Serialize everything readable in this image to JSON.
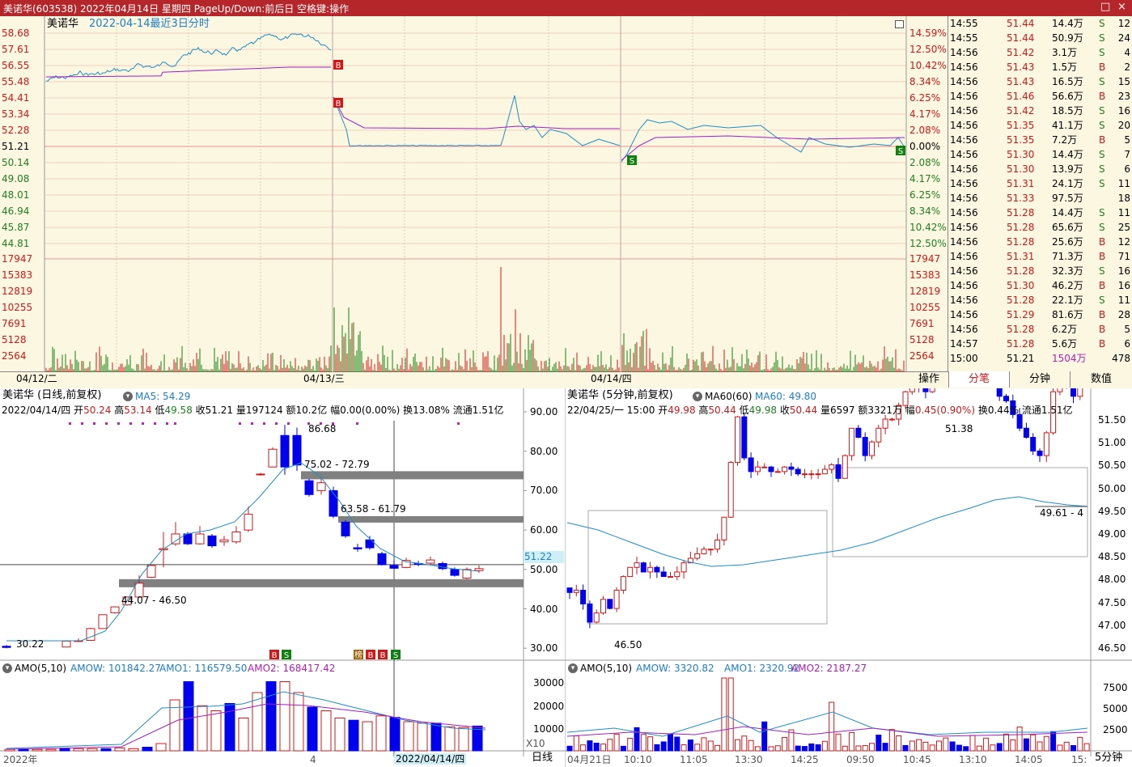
{
  "window": {
    "title": "美诺华(603538) 2022年04月14日 星期四 PageUp/Down:前后日 空格键:操作",
    "btn_restore": "□",
    "btn_close": "×"
  },
  "intraday": {
    "name": "美诺华",
    "period": "2022-04-14最近3日分时",
    "price_labels": [
      "58.68",
      "57.61",
      "56.55",
      "55.48",
      "54.41",
      "53.34",
      "52.28",
      "51.21",
      "50.14",
      "49.08",
      "48.01",
      "46.94",
      "45.87",
      "44.81"
    ],
    "pct_labels": [
      "14.59%",
      "12.50%",
      "10.42%",
      "8.34%",
      "6.25%",
      "4.17%",
      "2.08%",
      "0.00%",
      "2.08%",
      "4.17%",
      "6.25%",
      "8.34%",
      "10.42%",
      "12.50%"
    ],
    "vol_labels": [
      "17947",
      "15383",
      "12819",
      "10255",
      "7691",
      "5128",
      "2564"
    ],
    "dates": [
      "04/12/二",
      "04/13/三",
      "04/14/四"
    ],
    "markers": [
      "B",
      "B",
      "S",
      "S"
    ]
  },
  "ticks": [
    {
      "time": "14:55",
      "price": "51.44",
      "vol": "14.4万",
      "bs": "S",
      "n": "12"
    },
    {
      "time": "14:55",
      "price": "51.44",
      "vol": "50.9万",
      "bs": "S",
      "n": "24"
    },
    {
      "time": "14:56",
      "price": "51.42",
      "vol": "3.1万",
      "bs": "S",
      "n": "4"
    },
    {
      "time": "14:56",
      "price": "51.43",
      "vol": "1.5万",
      "bs": "B",
      "n": "2"
    },
    {
      "time": "14:56",
      "price": "51.43",
      "vol": "16.5万",
      "bs": "S",
      "n": "15"
    },
    {
      "time": "14:56",
      "price": "51.46",
      "vol": "56.6万",
      "bs": "B",
      "n": "23"
    },
    {
      "time": "14:56",
      "price": "51.42",
      "vol": "18.5万",
      "bs": "S",
      "n": "16"
    },
    {
      "time": "14:56",
      "price": "51.35",
      "vol": "41.1万",
      "bs": "S",
      "n": "20"
    },
    {
      "time": "14:56",
      "price": "51.35",
      "vol": "7.2万",
      "bs": "B",
      "n": "5"
    },
    {
      "time": "14:56",
      "price": "51.30",
      "vol": "14.4万",
      "bs": "S",
      "n": "7"
    },
    {
      "time": "14:56",
      "price": "51.30",
      "vol": "13.9万",
      "bs": "S",
      "n": "6"
    },
    {
      "time": "14:56",
      "price": "51.31",
      "vol": "24.1万",
      "bs": "S",
      "n": "11"
    },
    {
      "time": "14:56",
      "price": "51.33",
      "vol": "97.5万",
      "bs": "",
      "n": "18"
    },
    {
      "time": "14:56",
      "price": "51.28",
      "vol": "14.4万",
      "bs": "S",
      "n": "11"
    },
    {
      "time": "14:56",
      "price": "51.28",
      "vol": "65.6万",
      "bs": "S",
      "n": "25"
    },
    {
      "time": "14:56",
      "price": "51.28",
      "vol": "25.6万",
      "bs": "B",
      "n": "12"
    },
    {
      "time": "14:56",
      "price": "51.31",
      "vol": "71.3万",
      "bs": "B",
      "n": "71"
    },
    {
      "time": "14:56",
      "price": "51.28",
      "vol": "32.3万",
      "bs": "S",
      "n": "16"
    },
    {
      "time": "14:56",
      "price": "51.30",
      "vol": "46.2万",
      "bs": "B",
      "n": "16"
    },
    {
      "time": "14:56",
      "price": "51.28",
      "vol": "22.1万",
      "bs": "S",
      "n": "11"
    },
    {
      "time": "14:56",
      "price": "51.29",
      "vol": "81.6万",
      "bs": "B",
      "n": "28"
    },
    {
      "time": "14:56",
      "price": "51.28",
      "vol": "6.2万",
      "bs": "B",
      "n": "5"
    },
    {
      "time": "14:57",
      "price": "51.28",
      "vol": "5.6万",
      "bs": "B",
      "n": "6"
    },
    {
      "time": "15:00",
      "price": "51.21",
      "vol": "1504万",
      "bs": "",
      "n": "478"
    }
  ],
  "tabs": [
    "操作",
    "分笔",
    "分钟",
    "数值"
  ],
  "daily": {
    "title": "美诺华 (日线,前复权)",
    "ma_label": "MA5: 54.29",
    "info_date": "2022/04/14/四",
    "open_l": "开",
    "open": "50.24",
    "high_l": "高",
    "high": "53.14",
    "low_l": "低",
    "low": "49.58",
    "close_l": "收",
    "close": "51.21",
    "vol_l": "量",
    "vol": "197124",
    "amt_l": "额",
    "amt": "10.2亿",
    "range_l": "幅",
    "range": "0.00(0.00%)",
    "turn_l": "换",
    "turn": "13.08%",
    "flow_l": "流通",
    "flow": "1.51亿",
    "y_labels": [
      "90.00",
      "80.00",
      "70.00",
      "60.00",
      "50.00",
      "40.00",
      "30.00"
    ],
    "annotations": [
      "86.68",
      "75.02 - 72.79",
      "63.58 - 61.79",
      "44.07 - 46.50",
      "30.22"
    ],
    "price_box": "51.22",
    "amo_title": "AMO(5,10)",
    "amow": "AMOW: 101842.27",
    "amo1": "AMO1: 116579.50",
    "amo2": "AMO2: 168417.42",
    "amo_y": [
      "30000",
      "20000",
      "10000"
    ],
    "amo_unit": "X10",
    "x_labels": [
      "2022年",
      "4",
      "2022/04/14/四"
    ],
    "bottom_tab": "日线",
    "marker_text": "榜"
  },
  "m5": {
    "title": "美诺华 (5分钟,前复权)",
    "ma_label": "MA60(60)",
    "ma_val": "MA60: 49.80",
    "info_date": "22/04/25/一",
    "time": "15:00",
    "open": "49.98",
    "high": "50.44",
    "low": "49.98",
    "close": "50.44",
    "vol": "6597",
    "amt": "3321万",
    "range": "0.45(0.90%)",
    "turn": "0.44%",
    "flow": "1.51亿",
    "y_labels": [
      "51.50",
      "51.00",
      "50.50",
      "50.00",
      "49.50",
      "49.00",
      "48.50",
      "48.00",
      "47.50",
      "47.00",
      "46.50"
    ],
    "annotations": [
      "51.38",
      "46.50",
      "49.61 - 4"
    ],
    "amo_title": "AMO(5,10)",
    "amow": "AMOW: 3320.82",
    "amo1": "AMO1: 2320.92",
    "amo2": "AMO2: 2187.27",
    "amo_y": [
      "7500",
      "5000",
      "2500"
    ],
    "x_labels": [
      "04月21日",
      "10:10",
      "11:05",
      "13:30",
      "14:25",
      "09:50",
      "10:45",
      "13:10",
      "14:05",
      "15:"
    ],
    "bottom_tab": "5分钟"
  },
  "colors": {
    "up": "#d01818",
    "down": "#0000ee",
    "price": "#1c8ec8",
    "avg": "#a020c0",
    "grid": "#e0a0a0"
  }
}
